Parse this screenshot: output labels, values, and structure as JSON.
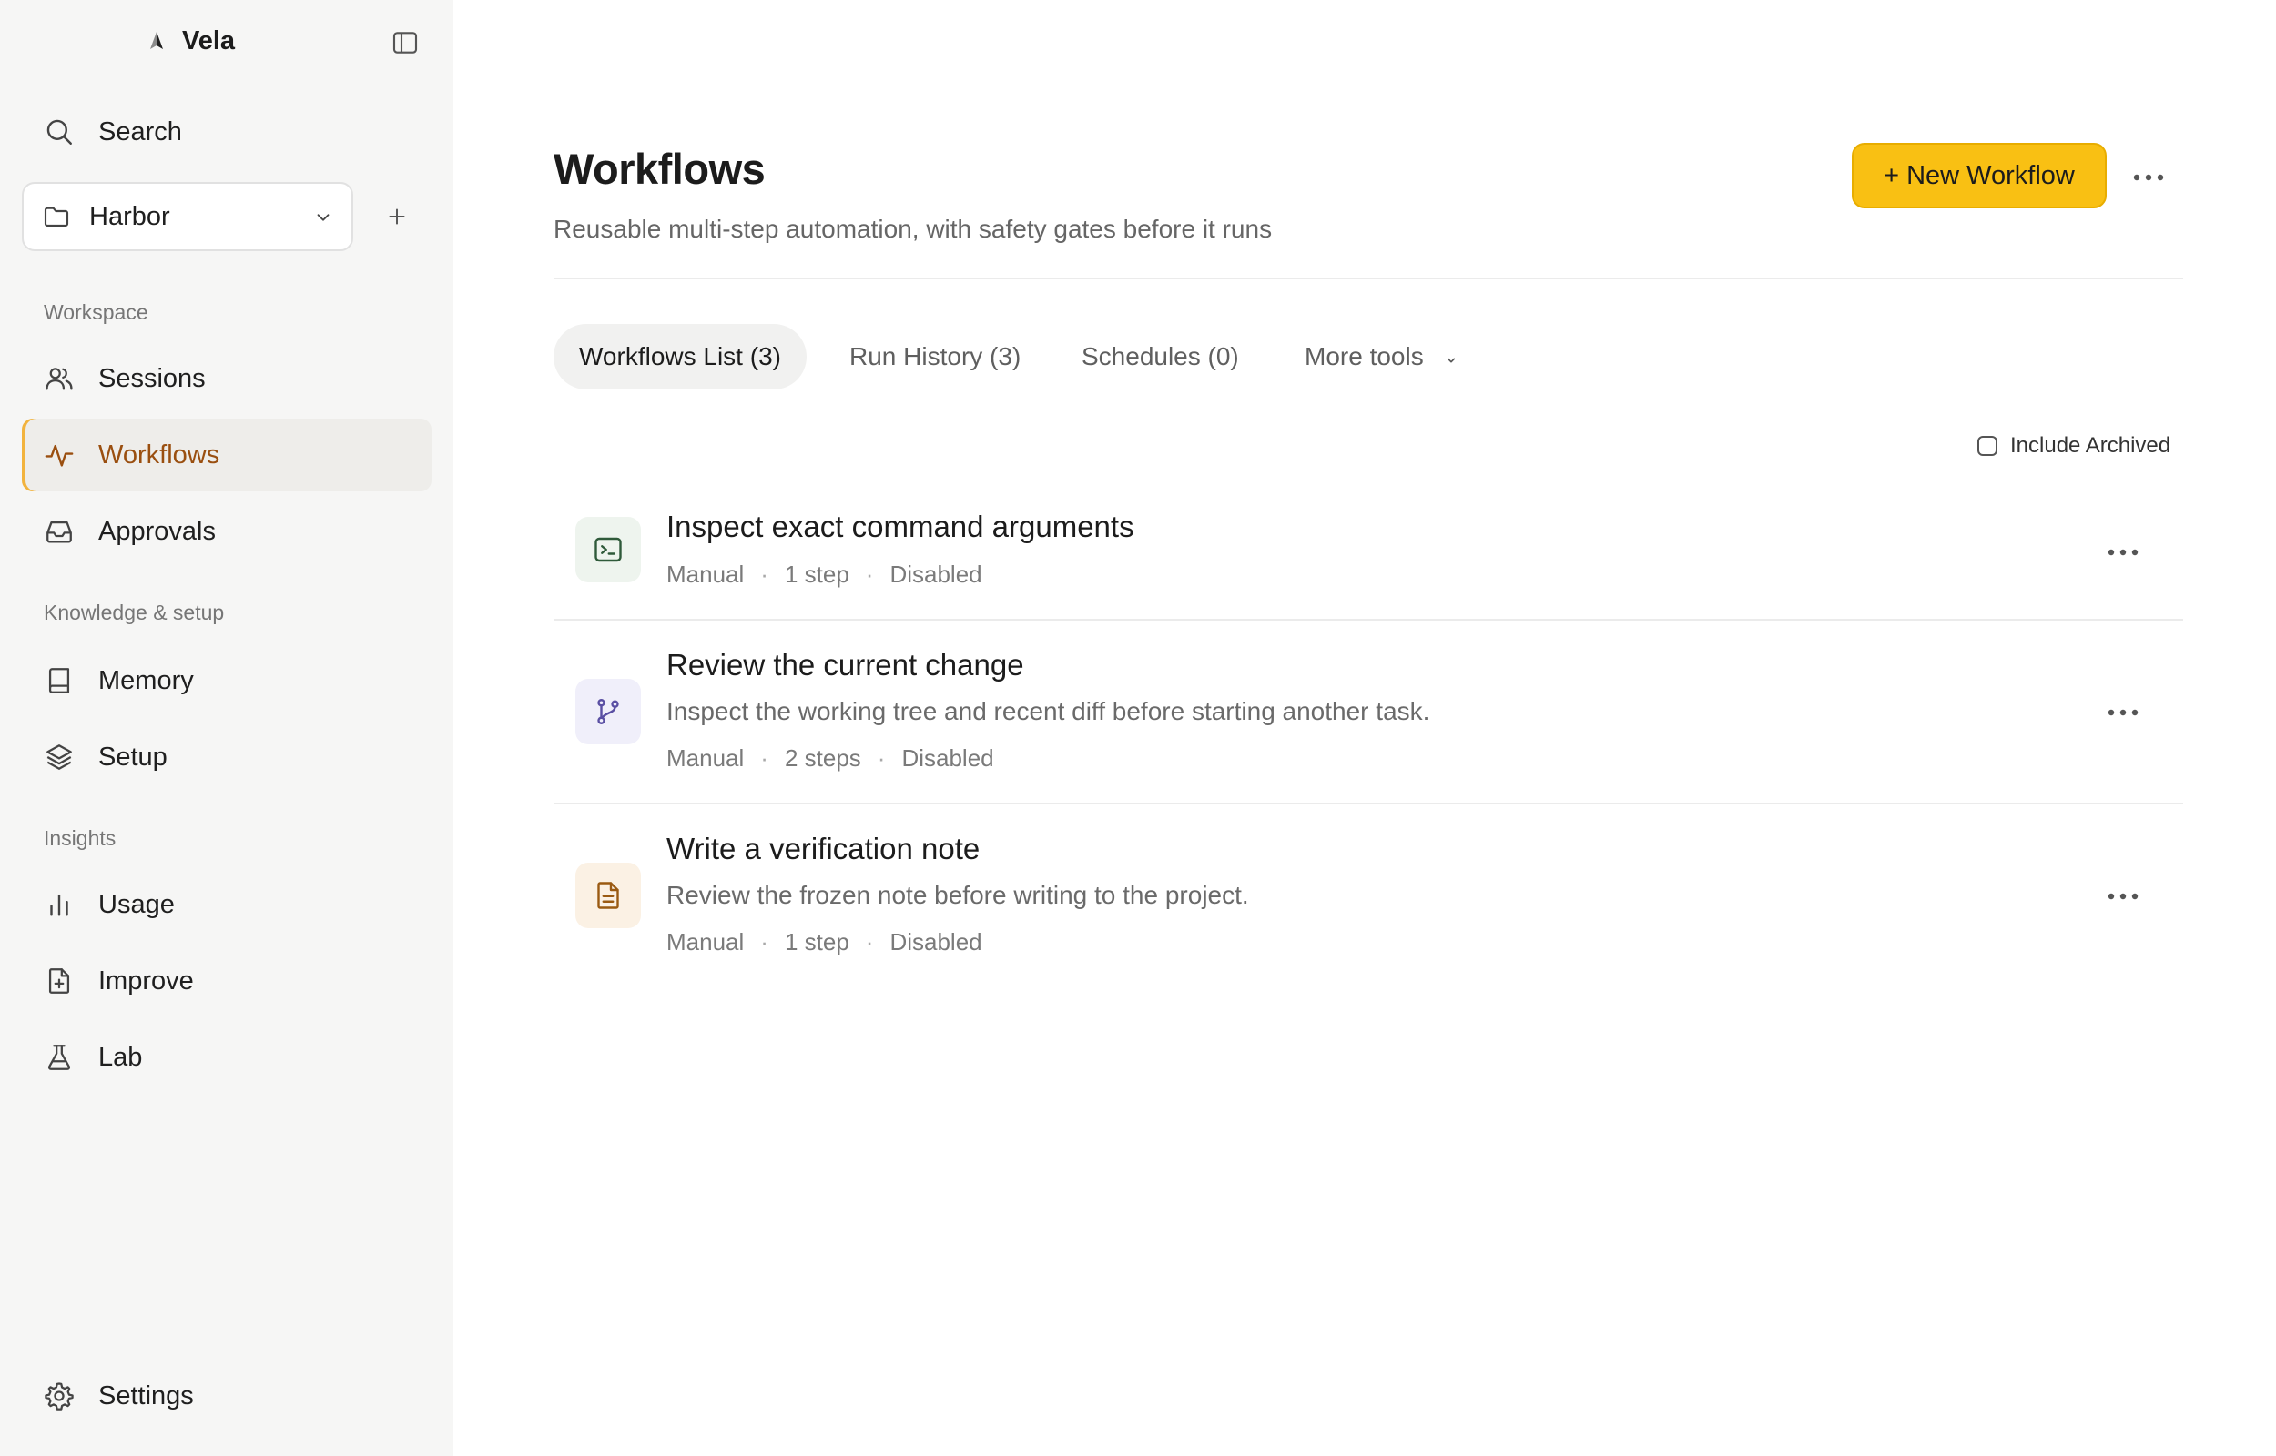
{
  "app": {
    "name": "Vela"
  },
  "sidebar": {
    "search_label": "Search",
    "project": {
      "name": "Harbor"
    },
    "sections": [
      {
        "label": "Workspace"
      },
      {
        "label": "Knowledge & setup"
      },
      {
        "label": "Insights"
      }
    ],
    "items": [
      {
        "label": "Sessions",
        "icon": "users-icon"
      },
      {
        "label": "Workflows",
        "icon": "activity-icon",
        "active": true
      },
      {
        "label": "Approvals",
        "icon": "inbox-icon"
      },
      {
        "label": "Memory",
        "icon": "book-icon"
      },
      {
        "label": "Setup",
        "icon": "layers-icon"
      },
      {
        "label": "Usage",
        "icon": "bar-chart-icon"
      },
      {
        "label": "Improve",
        "icon": "file-plus-icon"
      },
      {
        "label": "Lab",
        "icon": "flask-icon"
      }
    ],
    "settings_label": "Settings"
  },
  "header": {
    "title": "Workflows",
    "subtitle": "Reusable multi-step automation, with safety gates before it runs",
    "new_button_label": "+ New Workflow"
  },
  "tabs": [
    {
      "label": "Workflows List (3)",
      "active": true
    },
    {
      "label": "Run History (3)"
    },
    {
      "label": "Schedules (0)"
    },
    {
      "label": "More tools"
    }
  ],
  "filters": {
    "include_archived_label": "Include Archived",
    "include_archived_checked": false
  },
  "workflows": [
    {
      "title": "Inspect exact command arguments",
      "description": "",
      "trigger": "Manual",
      "steps": "1 step",
      "status": "Disabled",
      "icon": "terminal-icon"
    },
    {
      "title": "Review the current change",
      "description": "Inspect the working tree and recent diff before starting another task.",
      "trigger": "Manual",
      "steps": "2 steps",
      "status": "Disabled",
      "icon": "git-branch-icon"
    },
    {
      "title": "Write a verification note",
      "description": "Review the frozen note before writing to the project.",
      "trigger": "Manual",
      "steps": "1 step",
      "status": "Disabled",
      "icon": "document-icon"
    }
  ],
  "colors": {
    "accent": "#f9c013",
    "active_nav_text": "#9a4f10",
    "active_nav_bar": "#f2b33d",
    "sidebar_bg": "#f6f6f5",
    "icon_green_bg": "#eef4ee",
    "icon_purple_bg": "#f0effa",
    "icon_orange_bg": "#fbf1e4"
  }
}
